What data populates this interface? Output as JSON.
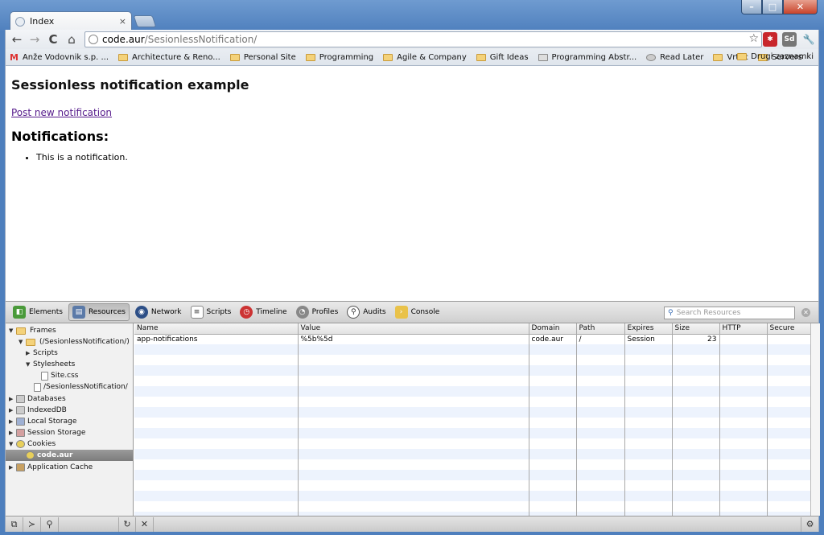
{
  "window": {
    "min": "–",
    "max": "□",
    "close": "✕"
  },
  "tab": {
    "title": "Index",
    "close": "×"
  },
  "toolbar": {
    "back": "←",
    "forward": "→",
    "reload": "C",
    "home": "⌂",
    "url_host": "code.aur",
    "url_path": "/SesionlessNotification/",
    "star": "☆",
    "ext1": "✱",
    "ext2": "Sd",
    "wrench": "🔧"
  },
  "bookmarks": {
    "items": [
      {
        "label": "Anže Vodovnik s.p. ..."
      },
      {
        "label": "Architecture & Reno..."
      },
      {
        "label": "Personal Site"
      },
      {
        "label": "Programming"
      },
      {
        "label": "Agile & Company"
      },
      {
        "label": "Gift Ideas"
      },
      {
        "label": "Programming Abstr..."
      },
      {
        "label": "Read Later"
      },
      {
        "label": "Vrtec"
      },
      {
        "label": "Servers"
      }
    ],
    "other": "Drugi zaznamki"
  },
  "page": {
    "heading": "Sessionless notification example",
    "link": "Post new notification",
    "subheading": "Notifications:",
    "items": [
      "This is a notification."
    ]
  },
  "devtools": {
    "tabs": [
      "Elements",
      "Resources",
      "Network",
      "Scripts",
      "Timeline",
      "Profiles",
      "Audits",
      "Console"
    ],
    "search_placeholder": "Search Resources",
    "tree": {
      "frames": "Frames",
      "frame": "(/SesionlessNotification/)",
      "scripts": "Scripts",
      "stylesheets": "Stylesheets",
      "sitecss": "Site.css",
      "doc": "/SesionlessNotification/",
      "databases": "Databases",
      "indexeddb": "IndexedDB",
      "localstorage": "Local Storage",
      "sessionstorage": "Session Storage",
      "cookies": "Cookies",
      "cookie_host": "code.aur",
      "appcache": "Application Cache"
    },
    "columns": [
      "Name",
      "Value",
      "Domain",
      "Path",
      "Expires",
      "Size",
      "HTTP",
      "Secure"
    ],
    "rows": [
      {
        "name": "app-notifications",
        "value": "%5b%5d",
        "domain": "code.aur",
        "path": "/",
        "expires": "Session",
        "size": "23",
        "http": "",
        "secure": ""
      }
    ]
  },
  "colors": {
    "link": "#551a8b",
    "row_alt": "#edf3fd",
    "selected": "#8a8a8a"
  }
}
